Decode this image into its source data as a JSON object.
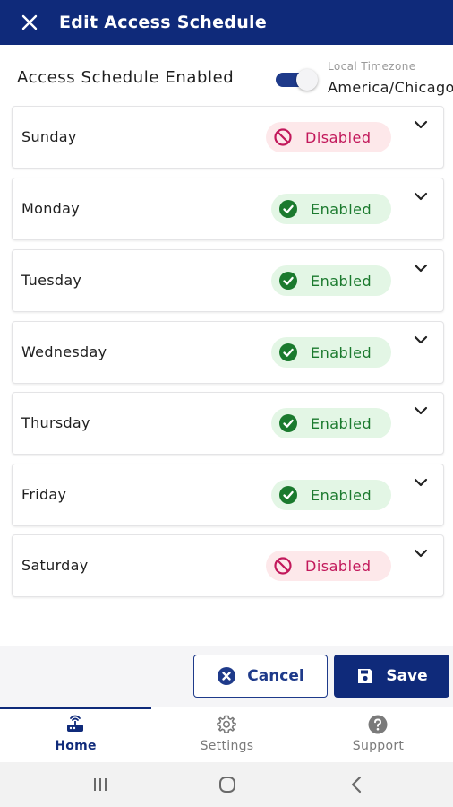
{
  "header": {
    "title": "Edit Access Schedule",
    "close_icon": "close-icon"
  },
  "schedule_toggle": {
    "label": "Access Schedule Enabled",
    "on": true
  },
  "timezone": {
    "label": "Local Timezone",
    "value": "America/Chicago"
  },
  "days": [
    {
      "name": "Sunday",
      "status": "Disabled",
      "enabled": false
    },
    {
      "name": "Monday",
      "status": "Enabled",
      "enabled": true
    },
    {
      "name": "Tuesday",
      "status": "Enabled",
      "enabled": true
    },
    {
      "name": "Wednesday",
      "status": "Enabled",
      "enabled": true
    },
    {
      "name": "Thursday",
      "status": "Enabled",
      "enabled": true
    },
    {
      "name": "Friday",
      "status": "Enabled",
      "enabled": true
    },
    {
      "name": "Saturday",
      "status": "Disabled",
      "enabled": false
    }
  ],
  "actions": {
    "cancel_label": "Cancel",
    "save_label": "Save"
  },
  "nav": {
    "items": [
      {
        "label": "Home",
        "icon": "router-icon",
        "active": true
      },
      {
        "label": "Settings",
        "icon": "gear-icon",
        "active": false
      },
      {
        "label": "Support",
        "icon": "help-icon",
        "active": false
      }
    ]
  },
  "colors": {
    "brand": "#0f2a7a",
    "enabled_text": "#1b7a2e",
    "enabled_bg": "#e3f6e5",
    "disabled_text": "#c2185b",
    "disabled_bg": "#fde8ea"
  }
}
